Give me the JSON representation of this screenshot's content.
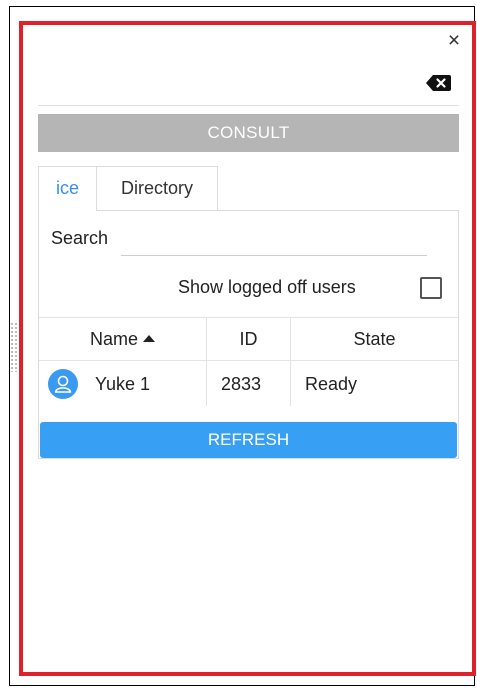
{
  "header": {
    "close_glyph": "×"
  },
  "consult": {
    "title": "CONSULT"
  },
  "tabs": [
    {
      "label": "ice",
      "active": true
    },
    {
      "label": "Directory",
      "active": false
    }
  ],
  "search": {
    "label": "Search",
    "value": ""
  },
  "filter": {
    "show_logged_off_label": "Show logged off users",
    "checked": false
  },
  "table": {
    "columns": [
      "Name",
      "ID",
      "State"
    ],
    "sort": {
      "column": "Name",
      "direction": "asc"
    },
    "rows": [
      {
        "name": "Yuke 1",
        "id": "2833",
        "state": "Ready"
      }
    ]
  },
  "actions": {
    "refresh_label": "REFRESH"
  },
  "colors": {
    "accent": "#37a0f4",
    "highlight_border": "#e0202a",
    "consult_bar": "#b5b5b5"
  },
  "icons": {
    "close": "close-icon",
    "clear": "backspace-icon",
    "avatar": "user-icon",
    "drag": "drag-handle-icon"
  }
}
